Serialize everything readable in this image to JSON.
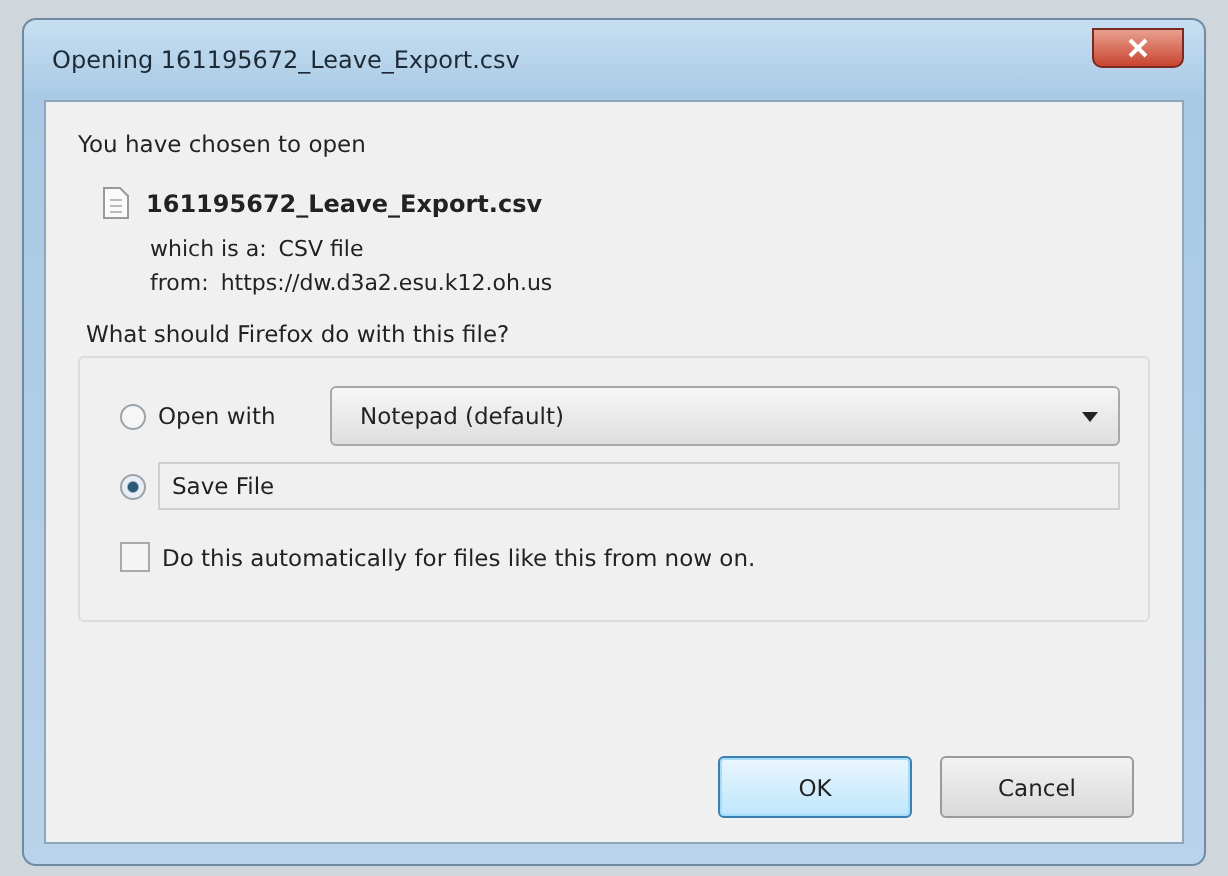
{
  "window": {
    "title": "Opening 161195672_Leave_Export.csv"
  },
  "intro": "You have chosen to open",
  "file": {
    "name": "161195672_Leave_Export.csv",
    "type_label": "which is a:",
    "type": "CSV file",
    "source_label": "from:",
    "source": "https://dw.d3a2.esu.k12.oh.us"
  },
  "question": "What should Firefox do with this file?",
  "actions": [
    {
      "kind": "open",
      "label": "Open with",
      "selected": false,
      "application": "Notepad (default)"
    },
    {
      "kind": "save",
      "label": "Save File",
      "selected": true
    }
  ],
  "remember": {
    "label": "Do this automatically for files like this from now on.",
    "checked": false
  },
  "buttons": [
    {
      "label": "OK",
      "default": true
    },
    {
      "label": "Cancel",
      "default": false
    }
  ]
}
